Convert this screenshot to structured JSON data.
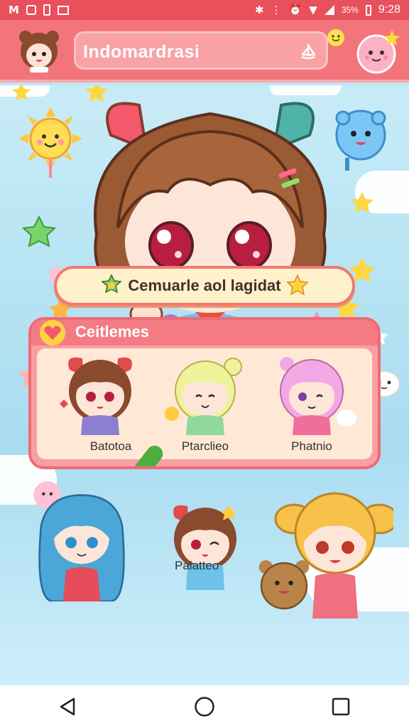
{
  "status_bar": {
    "left_icons": [
      "Ḿ",
      "app-icon",
      "sim-icon",
      "gallery-icon"
    ],
    "battery": "35%",
    "time": "9:28"
  },
  "header": {
    "search_text": "Indomardrasi",
    "search_icon": "sail-icon"
  },
  "banner": {
    "label": "Cemuarle aol lagidat"
  },
  "favorites_card": {
    "title": "Ceitlemes",
    "items": [
      {
        "label": "Batotoa",
        "hair": "#8a4a2e",
        "outfit": "#8a7fd0"
      },
      {
        "label": "Ptarclieo",
        "hair": "#eef29a",
        "outfit": "#8fd99a"
      },
      {
        "label": "Phatnio",
        "hair": "#f3a8e6",
        "outfit": "#f06f9a"
      }
    ]
  },
  "bottom_row": {
    "label": "Palatteo"
  },
  "colors": {
    "header": "#f4747c",
    "accent": "#f06a74",
    "sky": "#bfe6f5",
    "banner": "#fff1c9"
  },
  "nav": {
    "back_icon": "back-triangle-icon",
    "home_icon": "home-circle-icon",
    "recents_icon": "recents-square-icon"
  }
}
